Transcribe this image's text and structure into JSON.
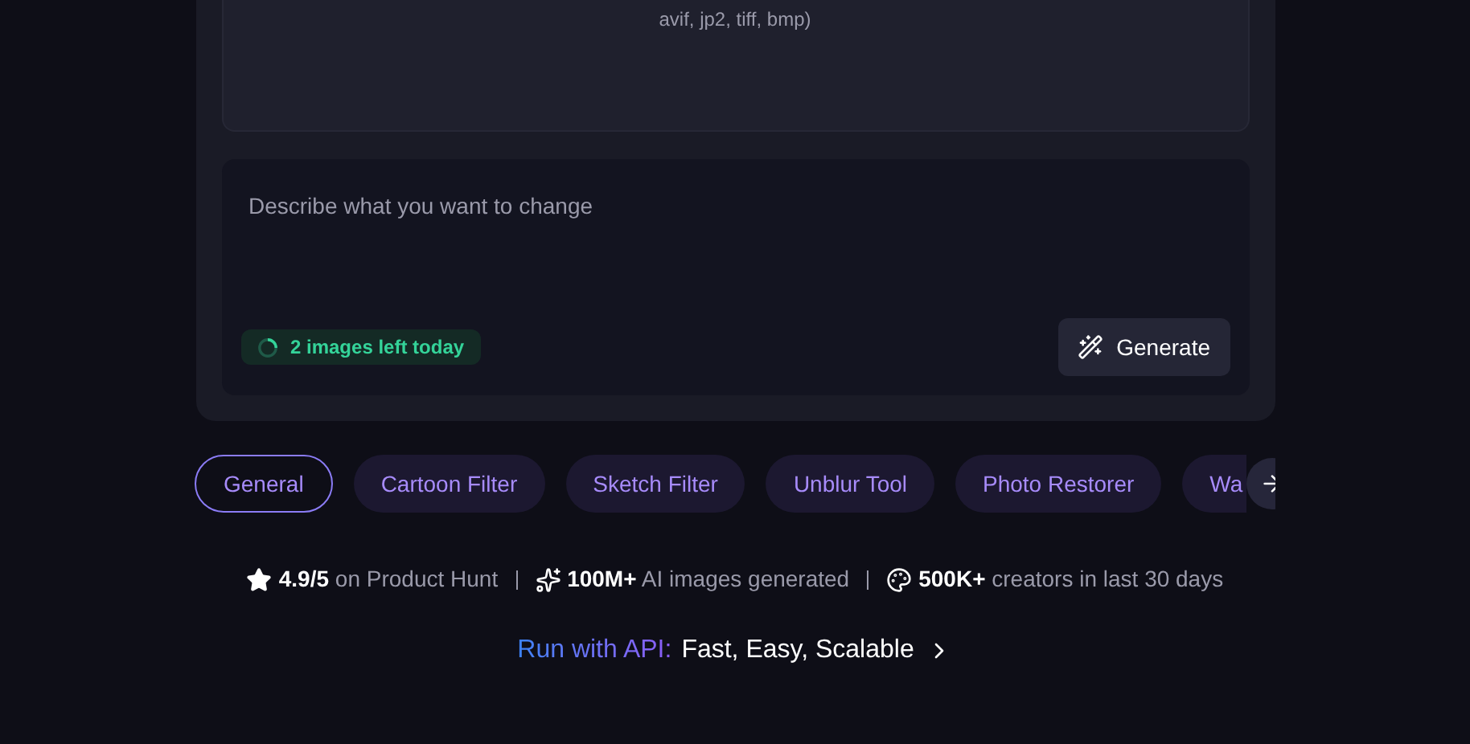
{
  "upload": {
    "formats": "avif, jp2, tiff, bmp)"
  },
  "prompt": {
    "placeholder": "Describe what you want to change",
    "quota": "2 images left today",
    "button": "Generate"
  },
  "chips": [
    {
      "label": "General",
      "selected": true
    },
    {
      "label": "Cartoon Filter",
      "selected": false
    },
    {
      "label": "Sketch Filter",
      "selected": false
    },
    {
      "label": "Unblur Tool",
      "selected": false
    },
    {
      "label": "Photo Restorer",
      "selected": false
    },
    {
      "label": "Wa",
      "selected": false
    }
  ],
  "stats": [
    {
      "kind": "star",
      "text": "**4.9/5** on Product Hunt"
    },
    {
      "kind": "sparkle",
      "text": "**100M+** AI images generated"
    },
    {
      "kind": "palette",
      "text": "**500K+** creators in last 30 days"
    }
  ],
  "api": {
    "label": "Run with API:",
    "text": "Fast, Easy, Scalable"
  }
}
